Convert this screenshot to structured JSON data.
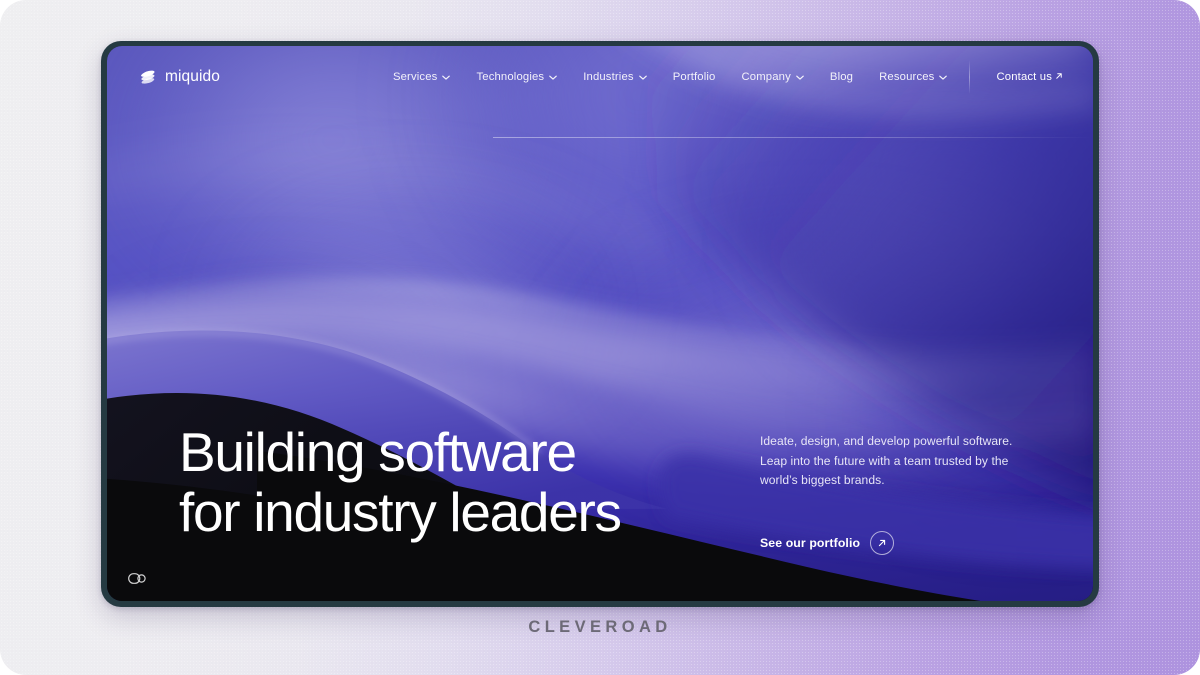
{
  "brand": {
    "logo_text": "miquido",
    "logo_icon": "miquido-layers-icon"
  },
  "nav": {
    "items": [
      {
        "label": "Services",
        "has_dropdown": true,
        "icon": "chevron-down-icon"
      },
      {
        "label": "Technologies",
        "has_dropdown": true,
        "icon": "chevron-down-icon"
      },
      {
        "label": "Industries",
        "has_dropdown": true,
        "icon": "chevron-down-icon"
      },
      {
        "label": "Portfolio",
        "has_dropdown": false,
        "icon": ""
      },
      {
        "label": "Company",
        "has_dropdown": true,
        "icon": "chevron-down-icon"
      },
      {
        "label": "Blog",
        "has_dropdown": false,
        "icon": ""
      },
      {
        "label": "Resources",
        "has_dropdown": true,
        "icon": "chevron-down-icon"
      }
    ],
    "contact": {
      "label": "Contact us",
      "icon": "arrow-up-right-icon"
    }
  },
  "hero": {
    "headline_line1": "Building software",
    "headline_line2": "for industry leaders",
    "subcopy": "Ideate, design, and develop powerful software. Leap into the future with a team trusted by the world’s biggest brands.",
    "cta": {
      "label": "See our portfolio",
      "icon": "arrow-up-right-circle-icon"
    }
  },
  "widgets": {
    "accessibility_icon": "accessibility-toggle-icon"
  },
  "watermark": {
    "text": "CLEVEROAD"
  },
  "colors": {
    "canvas_left": "#efeff1",
    "canvas_right": "#ae93df",
    "frame_border": "#253a42",
    "hero_dark": "#0a0a0c",
    "hero_purple": "#5753c4",
    "hero_deep_purple": "#251d84",
    "text_primary": "#ffffff",
    "text_secondary": "#e6e4f6",
    "watermark": "#6d6a77"
  }
}
